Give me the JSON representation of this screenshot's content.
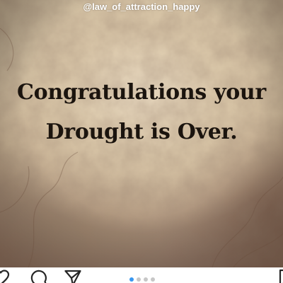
{
  "post": {
    "watermark_handle": "@law_of_attraction_happy",
    "quote_line_1": "Congratulations your",
    "quote_line_2": "Drought is Over."
  },
  "action_bar": {
    "icons": [
      "heart-icon",
      "comment-icon",
      "share-icon",
      "bookmark-icon"
    ],
    "carousel": {
      "total_slides": 4,
      "active_slide": 1,
      "active_color": "#3897f0",
      "inactive_color": "#c7c7c7"
    }
  }
}
